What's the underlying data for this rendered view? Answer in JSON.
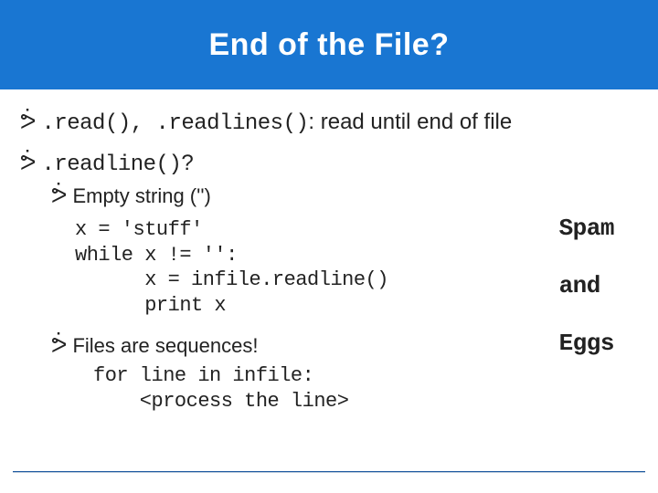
{
  "header": {
    "title": "End of the File?"
  },
  "bullets": {
    "b1_code": ".read(), .readlines()",
    "b1_rest": ": read until end of file",
    "b2_code": ".readline()",
    "b2_rest": "?",
    "sub1": "Empty string ('')",
    "code1": "x = 'stuff'\nwhile x != '':\n      x = infile.readline()\n      print x",
    "sub2": "Files are sequences!",
    "code2": "for line in infile:\n    <process the line>"
  },
  "output": {
    "o1": "Spam",
    "o2": "and",
    "o3": "Eggs"
  }
}
